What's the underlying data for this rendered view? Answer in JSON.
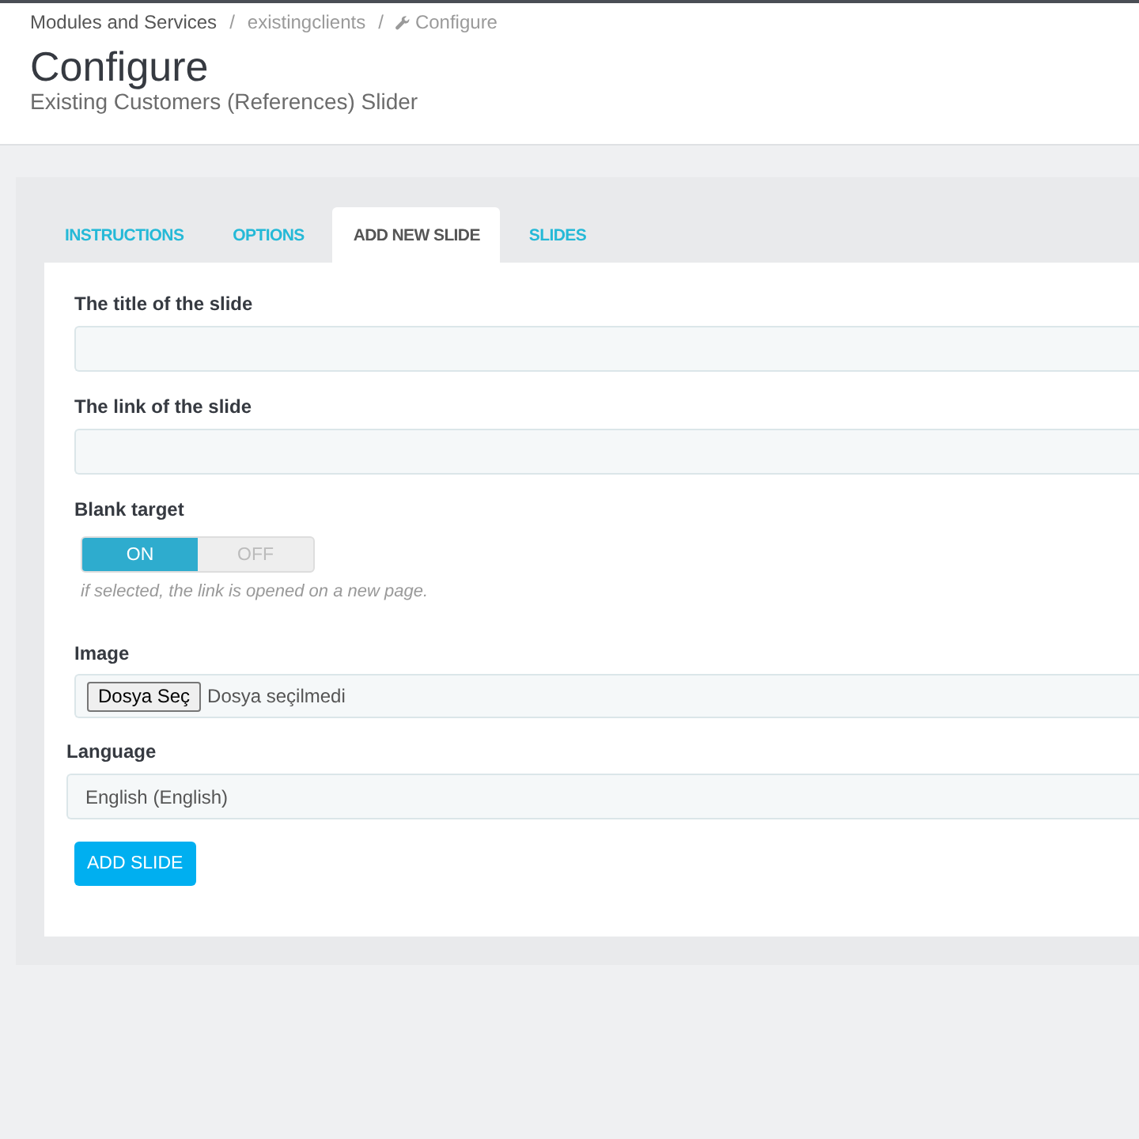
{
  "breadcrumb": [
    {
      "kind": "link",
      "label": "Modules and Services"
    },
    {
      "kind": "separator",
      "label": "/"
    },
    {
      "kind": "plain",
      "label": "existingclients"
    },
    {
      "kind": "separator",
      "label": "/"
    },
    {
      "kind": "current",
      "label": "Configure"
    }
  ],
  "page_header": {
    "title": "Configure",
    "subtitle": "Existing Customers (References) Slider"
  },
  "tabs": [
    {
      "label": "INSTRUCTIONS",
      "selected": false
    },
    {
      "label": "OPTIONS",
      "selected": false
    },
    {
      "label": "ADD NEW SLIDE",
      "selected": true
    },
    {
      "label": "SLIDES",
      "selected": false
    }
  ],
  "form": {
    "fields": [
      {
        "kind": "text",
        "label": "The title of the slide"
      },
      {
        "kind": "text",
        "label": "The link of the slide"
      },
      {
        "kind": "switch",
        "label": "Blank target",
        "options": [
          {
            "label": "ON",
            "selected": true
          },
          {
            "label": "OFF",
            "selected": false
          }
        ],
        "hint": "if selected, the link is opened on a new page."
      },
      {
        "kind": "file",
        "label": "Image",
        "button": "Dosya Seç",
        "status": "Dosya seçilmedi"
      },
      {
        "kind": "select",
        "label": "Language",
        "value": "English (English)"
      }
    ],
    "submit": "ADD SLIDE"
  }
}
